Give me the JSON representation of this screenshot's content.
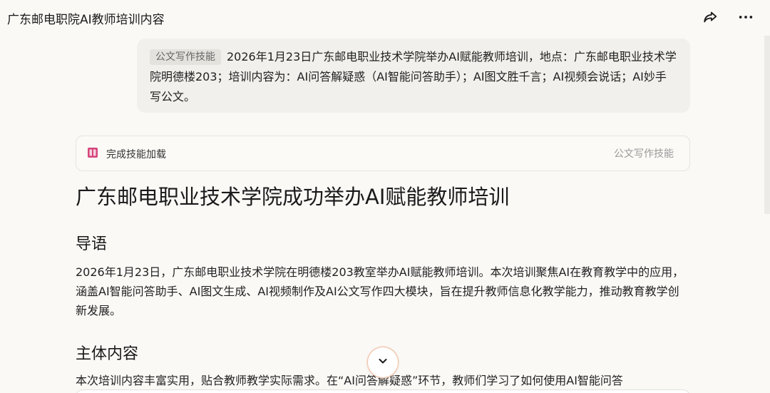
{
  "header": {
    "title": "广东邮电职院AI教师培训内容"
  },
  "user_message": {
    "tag": "公文写作技能",
    "text": "2026年1月23日广东邮电职业技术学院举办AI赋能教师培训，地点：广东邮电职业技术学院明德楼203；培训内容为：AI问答解疑惑（AI智能问答助手）；AI图文胜千言；AI视频会说话；AI妙手写公文。"
  },
  "skill_card": {
    "status": "完成技能加载",
    "skill_name": "公文写作技能"
  },
  "article": {
    "title": "广东邮电职业技术学院成功举办AI赋能教师培训",
    "lead_heading": "导语",
    "lead_text": "2026年1月23日，广东邮电职业技术学院在明德楼203教室举办AI赋能教师培训。本次培训聚焦AI在教育教学中的应用，涵盖AI智能问答助手、AI图文生成、AI视频制作及AI公文写作四大模块，旨在提升教师信息化教学能力，推动教育教学创新发展。",
    "main_heading": "主体内容",
    "main_text": "本次培训内容丰富实用，贴合教师教学实际需求。在“AI问答解疑惑”环节，教师们学习了如何使用AI智能问答"
  },
  "icons": {
    "share": "share-icon",
    "more": "more-icon",
    "skill": "skill-book-icon",
    "scroll": "chevron-down-icon"
  },
  "colors": {
    "background": "#faf9f6",
    "bubble": "#f1f0ec",
    "tag": "#e3e2dd",
    "skill_icon": "#d6457a",
    "scroll_ring": "#f3c9b3"
  }
}
